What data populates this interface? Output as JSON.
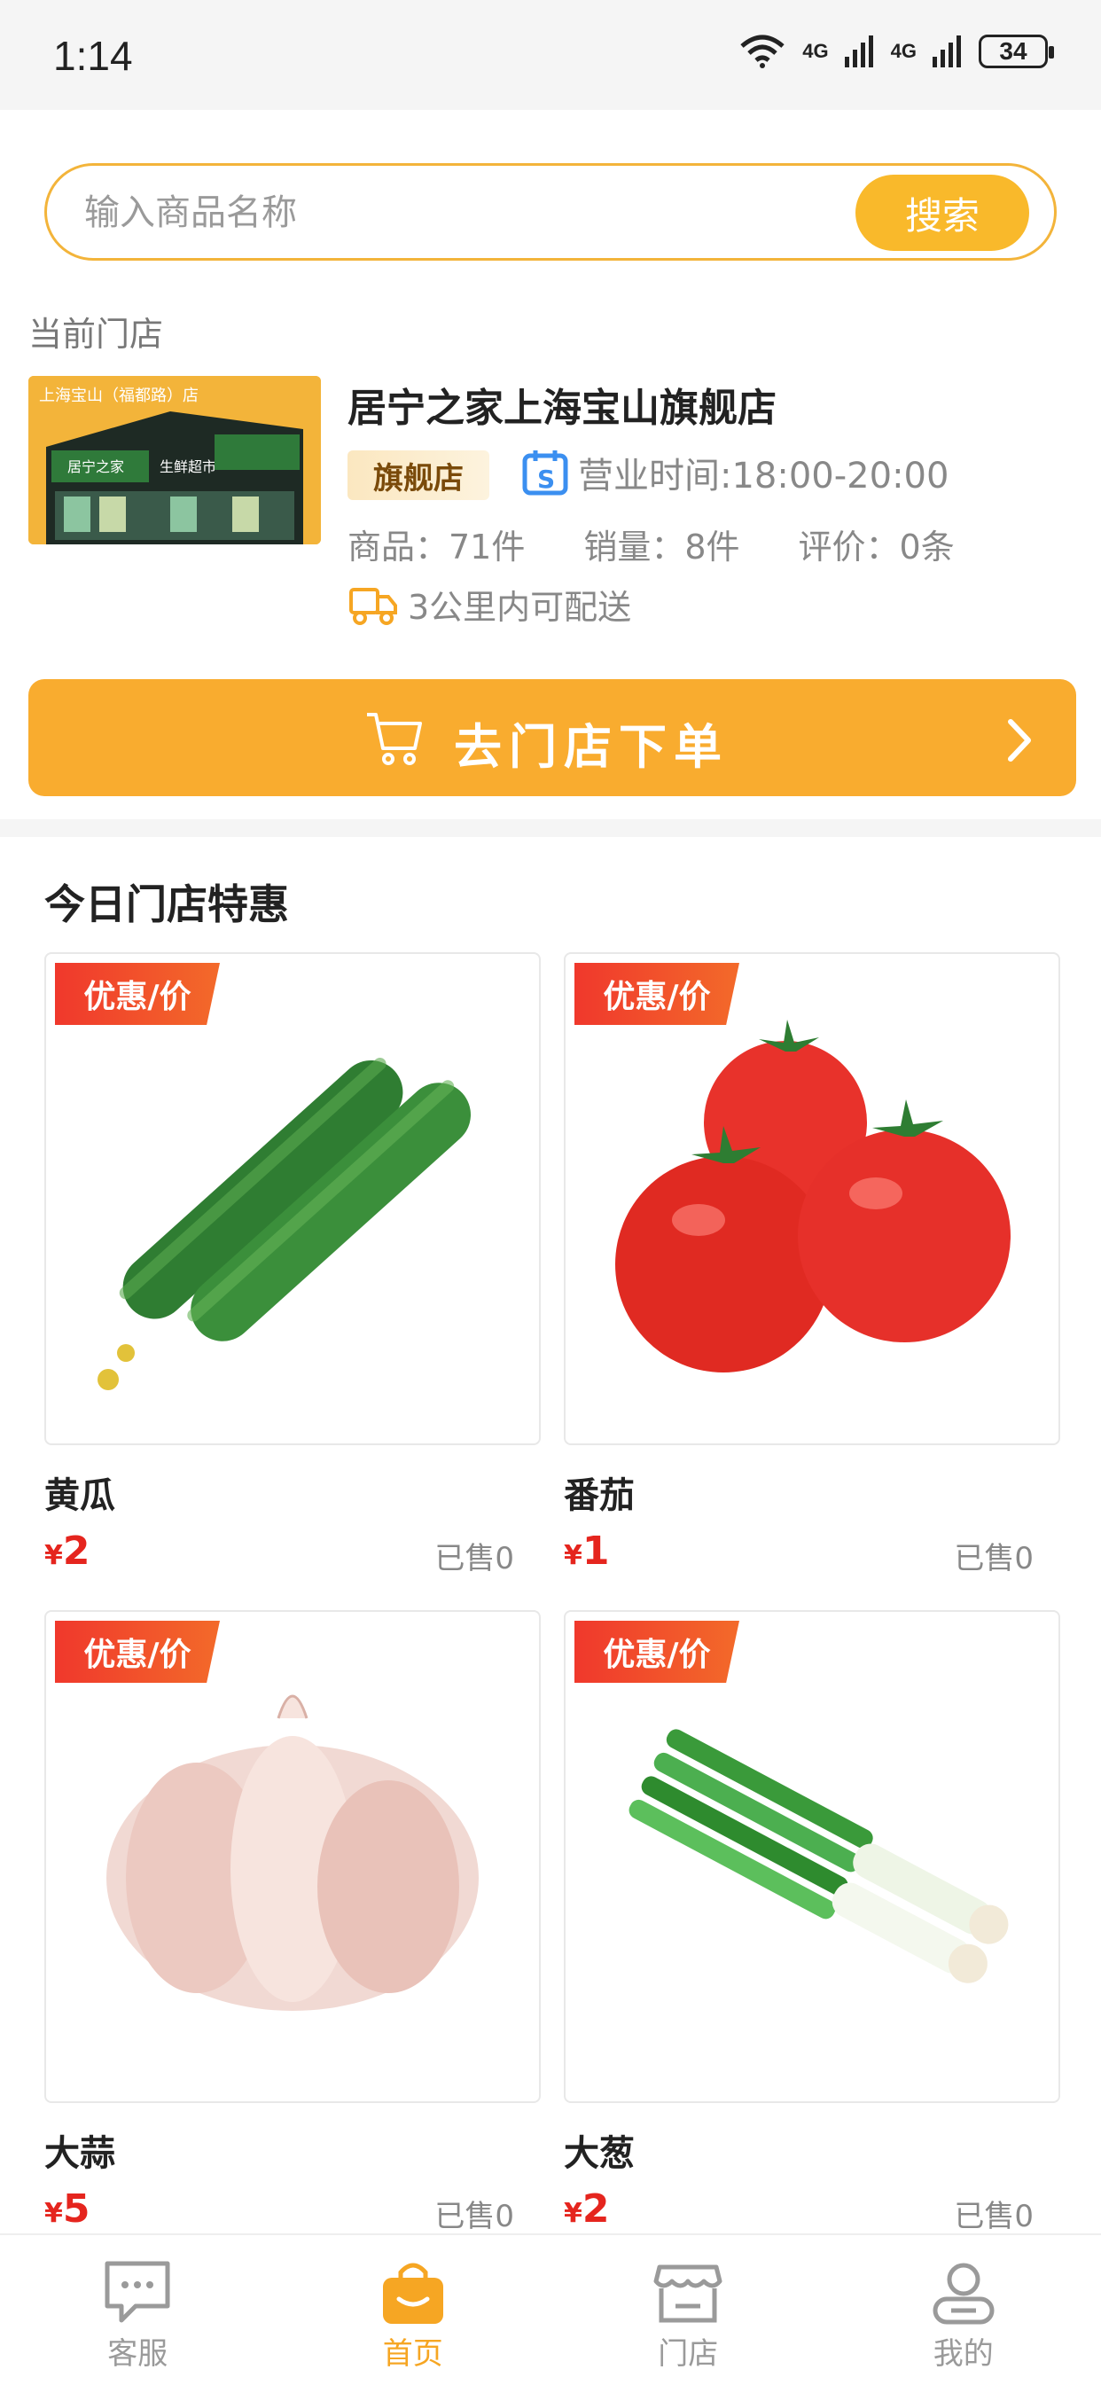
{
  "status_bar": {
    "time": "1:14",
    "battery": "34",
    "signal1": "4G",
    "signal2": "4G"
  },
  "search": {
    "placeholder": "输入商品名称",
    "button": "搜索"
  },
  "store": {
    "section_label": "当前门店",
    "name": "居宁之家上海宝山旗舰店",
    "badge": "旗舰店",
    "hours": "营业时间:18:00-20:00",
    "stats": [
      "商品：71件",
      "销量：8件",
      "评价：0条"
    ],
    "delivery": "3公里内可配送",
    "photo_sign": "上海宝山（福都路）店",
    "photo_shop": "生鲜超市",
    "order_button": "去门店下单"
  },
  "deals": {
    "title": "今日门店特惠",
    "items": [
      {
        "tag": "优惠/价",
        "name": "黄瓜",
        "currency": "¥",
        "price": "2",
        "sold": "已售0"
      },
      {
        "tag": "优惠/价",
        "name": "番茄",
        "currency": "¥",
        "price": "1",
        "sold": "已售0"
      },
      {
        "tag": "优惠/价",
        "name": "大蒜",
        "currency": "¥",
        "price": "5",
        "sold": "已售0"
      },
      {
        "tag": "优惠/价",
        "name": "大葱",
        "currency": "¥",
        "price": "2",
        "sold": "已售0"
      }
    ]
  },
  "tabbar": [
    {
      "label": "客服",
      "icon": "chat-icon"
    },
    {
      "label": "首页",
      "icon": "shopping-bag-icon",
      "active": true
    },
    {
      "label": "门店",
      "icon": "store-icon"
    },
    {
      "label": "我的",
      "icon": "user-icon"
    }
  ],
  "colors": {
    "accent": "#f9ac2f",
    "price_red": "#e5251e",
    "tag_red": "#f0382c"
  }
}
